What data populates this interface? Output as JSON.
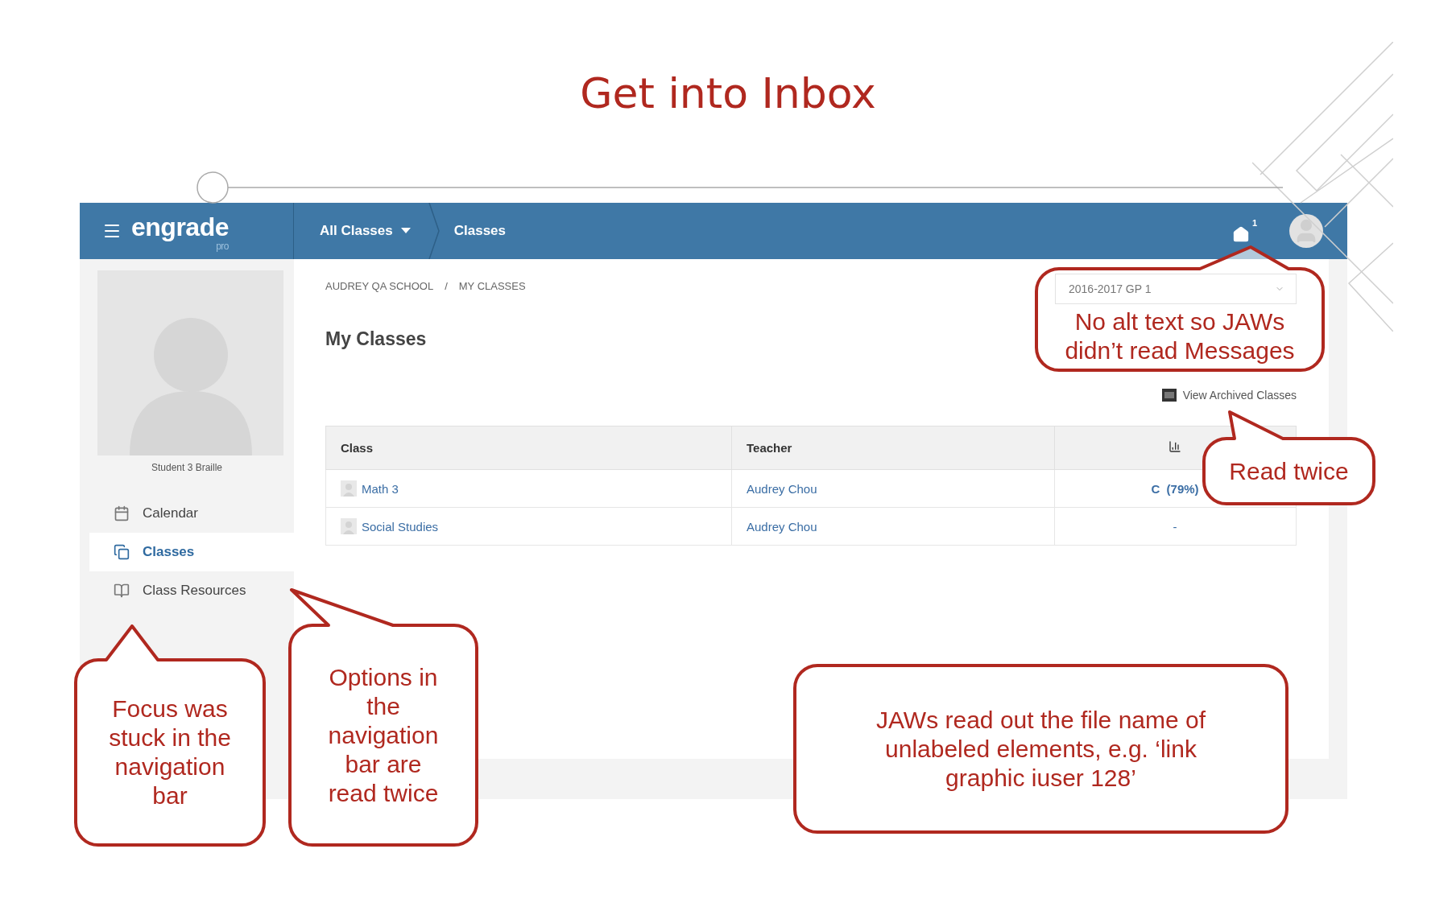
{
  "slide": {
    "title": "Get into Inbox"
  },
  "app": {
    "logo": "engrade",
    "logo_sub": "pro",
    "class_menu": "All Classes",
    "crumb": "Classes",
    "messages_badge": "1"
  },
  "sidebar": {
    "student": "Student 3 Braille",
    "items": [
      {
        "label": "Calendar",
        "kind": "calendar",
        "selected": false
      },
      {
        "label": "Classes",
        "kind": "classes",
        "selected": true
      },
      {
        "label": "Class Resources",
        "kind": "resources",
        "selected": false
      }
    ]
  },
  "main": {
    "breadcrumb": [
      "AUDREY QA SCHOOL",
      "MY CLASSES"
    ],
    "breadcrumb_separator": "/",
    "heading": "My Classes",
    "period_select": "2016-2017 GP 1",
    "archived_link": "View Archived Classes",
    "table": {
      "columns": [
        "Class",
        "Teacher"
      ],
      "rows": [
        {
          "class": "Math 3",
          "teacher": "Audrey Chou",
          "grade": "C  (79%)"
        },
        {
          "class": "Social Studies",
          "teacher": "Audrey Chou",
          "grade": "-"
        }
      ]
    }
  },
  "callouts": [
    {
      "text": "No alt text so JAWs\ndidn’t read Messages"
    },
    {
      "text": "Read twice"
    },
    {
      "text": "Focus was\nstuck in the\nnavigation\nbar"
    },
    {
      "text": "Options in\nthe\nnavigation\nbar are\nread twice"
    },
    {
      "text": "JAWs read out the file name of\nunlabeled elements, e.g. ‘link\ngraphic iuser 128’"
    }
  ]
}
